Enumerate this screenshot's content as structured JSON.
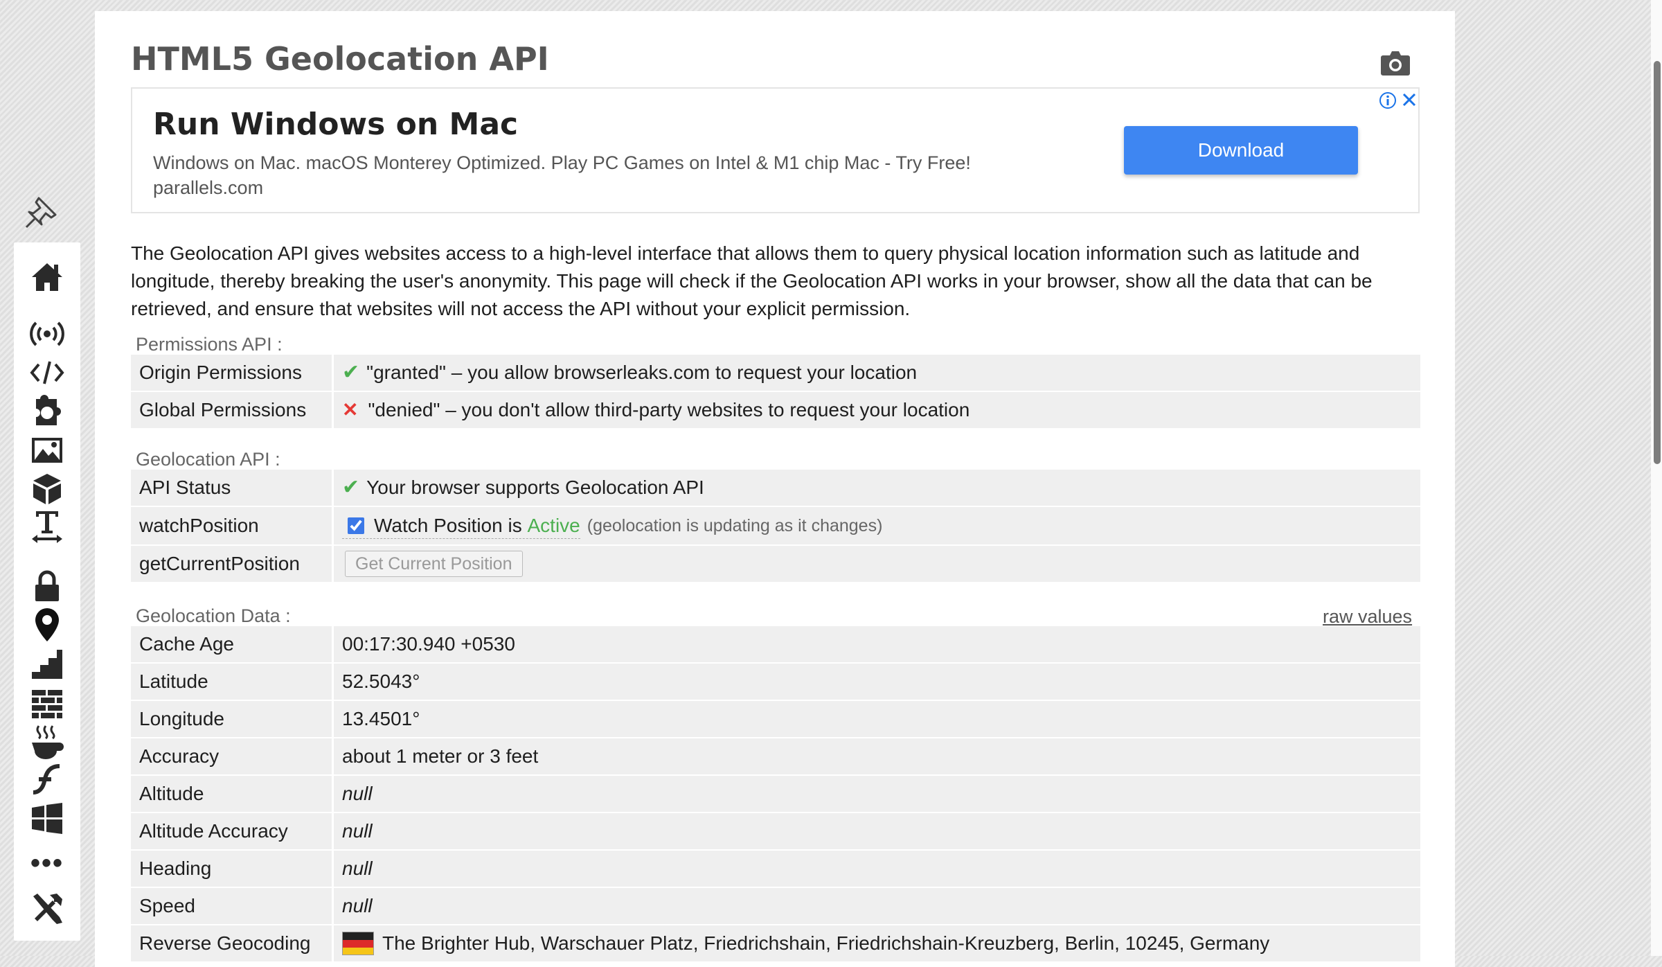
{
  "page": {
    "title": "HTML5 Geolocation API"
  },
  "ad": {
    "title": "Run Windows on Mac",
    "text": "Windows on Mac. macOS Monterey Optimized. Play PC Games on Intel & M1 chip Mac - Try Free!",
    "domain": "parallels.com",
    "button": "Download"
  },
  "description": "The Geolocation API gives websites access to a high-level interface that allows them to query physical location information such as latitude and longitude, thereby breaking the user's anonymity. This page will check if the Geolocation API works in your browser, show all the data that can be retrieved, and ensure that websites will not access the API without your explicit permission.",
  "permissions": {
    "heading": "Permissions API :",
    "rows": [
      {
        "label": "Origin Permissions",
        "value": "\"granted\" – you allow browserleaks.com to request your location"
      },
      {
        "label": "Global Permissions",
        "value": "\"denied\" – you don't allow third-party websites to request your location"
      }
    ]
  },
  "geolocation_api": {
    "heading": "Geolocation API :",
    "api_status": {
      "label": "API Status",
      "value": "Your browser supports Geolocation API"
    },
    "watch": {
      "label": "watchPosition",
      "text": "Watch Position is",
      "state": "Active",
      "hint": "(geolocation is updating as it changes)",
      "checked": true
    },
    "current": {
      "label": "getCurrentPosition",
      "button": "Get Current Position"
    }
  },
  "geolocation_data": {
    "heading": "Geolocation Data :",
    "raw_link": "raw values",
    "rows": [
      {
        "label": "Cache Age",
        "value": "00:17:30.940 +0530"
      },
      {
        "label": "Latitude",
        "value": "52.5043°"
      },
      {
        "label": "Longitude",
        "value": "13.4501°"
      },
      {
        "label": "Accuracy",
        "value": "about 1 meter or 3 feet"
      },
      {
        "label": "Altitude",
        "value": "null"
      },
      {
        "label": "Altitude Accuracy",
        "value": "null"
      },
      {
        "label": "Heading",
        "value": "null"
      },
      {
        "label": "Speed",
        "value": "null"
      },
      {
        "label": "Reverse Geocoding",
        "value": "The Brighter Hub, Warschauer Platz, Friedrichshain, Friedrichshain-Kreuzberg, Berlin, 10245, Germany"
      }
    ]
  },
  "sidebar": {
    "icons": [
      "home-icon",
      "broadcast-icon",
      "code-icon",
      "puzzle-icon",
      "image-icon",
      "cube-icon",
      "text-width-icon",
      "lock-icon",
      "map-marker-icon",
      "stairs-icon",
      "firewall-icon",
      "java-coffee-icon",
      "flash-icon",
      "windows-icon",
      "more-dots-icon",
      "tools-icon"
    ],
    "more": "•••"
  },
  "colors": {
    "accent": "#3e86f2",
    "ok": "#4caf50",
    "error": "#e53935"
  },
  "flag": "germany-flag-icon"
}
